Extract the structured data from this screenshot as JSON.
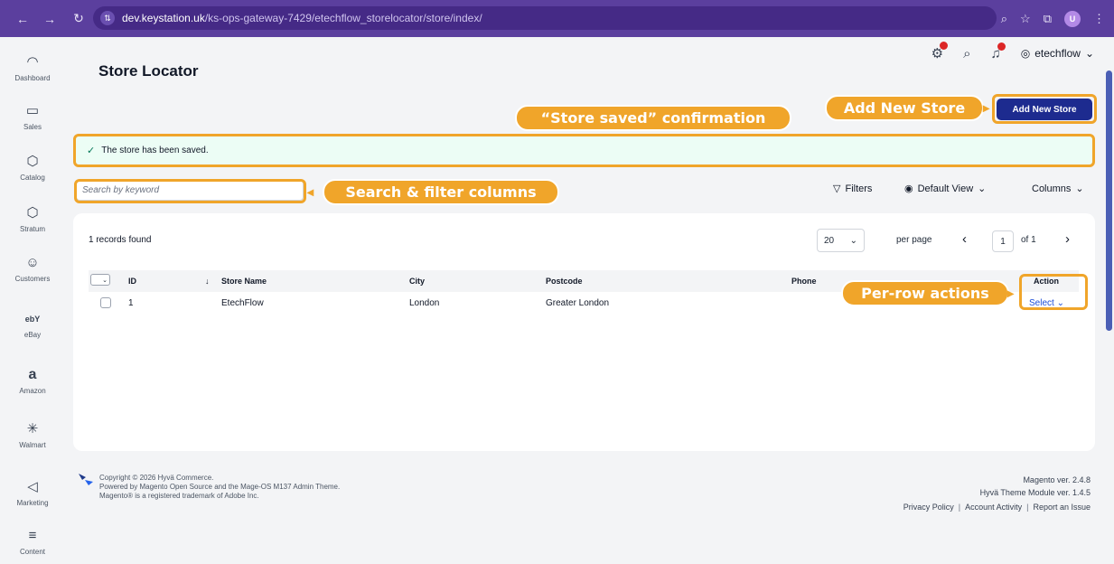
{
  "browser": {
    "url_domain": "dev.keystation.uk",
    "url_path": "/ks-ops-gateway-7429/etechflow_storelocator/store/index/",
    "profile_initial": "U"
  },
  "sidebar": {
    "items": [
      {
        "label": "Dashboard",
        "icon": "dashboard-icon"
      },
      {
        "label": "Sales",
        "icon": "sales-icon"
      },
      {
        "label": "Catalog",
        "icon": "catalog-icon"
      },
      {
        "label": "Stratum",
        "icon": "stratum-icon"
      },
      {
        "label": "Customers",
        "icon": "customers-icon"
      },
      {
        "label": "eBay",
        "icon": "ebay-icon"
      },
      {
        "label": "Amazon",
        "icon": "amazon-icon"
      },
      {
        "label": "Walmart",
        "icon": "walmart-icon"
      },
      {
        "label": "Marketing",
        "icon": "marketing-icon"
      },
      {
        "label": "Content",
        "icon": "content-icon"
      }
    ],
    "ebay_glyph": "ebY",
    "amazon_glyph": "a"
  },
  "header": {
    "title": "Store Locator",
    "user": "etechflow",
    "add_button": "Add New Store"
  },
  "message": {
    "text": "The store has been saved."
  },
  "toolbar": {
    "search_placeholder": "Search by keyword",
    "filters": "Filters",
    "view": "Default View",
    "columns": "Columns"
  },
  "grid": {
    "records": "1 records found",
    "page_size": "20",
    "per_page": "per page",
    "page": "1",
    "of": "of 1",
    "columns": [
      "ID",
      "Store Name",
      "City",
      "Postcode",
      "Phone",
      "Action"
    ],
    "rows": [
      {
        "id": "1",
        "store_name": "EtechFlow",
        "city": "London",
        "postcode": "Greater London",
        "phone": "",
        "action": "Select"
      }
    ]
  },
  "footer": {
    "copyright": "Copyright © 2026 Hyvä Commerce.",
    "powered": "Powered by Magento Open Source and the Mage-OS M137 Admin Theme.",
    "trademark": "Magento® is a registered trademark of Adobe Inc.",
    "magento_ver": "Magento ver. 2.4.8",
    "theme_ver": "Hyvä Theme Module ver. 1.4.5",
    "links": [
      "Privacy Policy",
      "Account Activity",
      "Report an Issue"
    ]
  },
  "annotations": {
    "saved": "“Store saved” confirmation",
    "add": "Add New Store",
    "search": "Search & filter columns",
    "actions": "Per-row actions"
  },
  "colors": {
    "accent": "#f0a52a",
    "primary_button": "#1d2b8f",
    "success_bg": "#ecfdf5",
    "browser_bar": "#5b3f9e"
  }
}
